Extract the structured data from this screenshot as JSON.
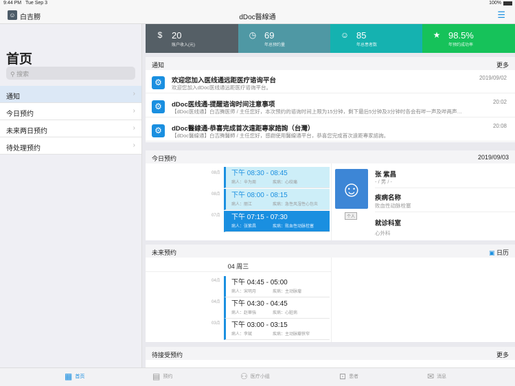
{
  "status": {
    "time": "9:44 PM",
    "date": "Tue Sep 3",
    "battery": "100%"
  },
  "nav": {
    "user": "白吉朥",
    "title": "dDoc醫線通"
  },
  "sidebar": {
    "title": "首页",
    "search_placeholder": "搜索",
    "items": [
      {
        "label": "通知"
      },
      {
        "label": "今日预约"
      },
      {
        "label": "未来两日预约"
      },
      {
        "label": "待处理预约"
      }
    ]
  },
  "stats": [
    {
      "value": "20",
      "label": "账户收入(元)",
      "color": "#555f66",
      "icon": "$"
    },
    {
      "value": "69",
      "label": "年总预约量",
      "color": "#4f98a4",
      "icon": "◷"
    },
    {
      "value": "85",
      "label": "年总患者数",
      "color": "#15b2b0",
      "icon": "☺"
    },
    {
      "value": "98.5%",
      "label": "年预约成功率",
      "color": "#16c25a",
      "icon": "★"
    }
  ],
  "notices": {
    "title": "通知",
    "more": "更多",
    "items": [
      {
        "title": "欢迎您加入医线通远距医疗谘询平台",
        "summary": "欢迎您加入dDoc医线通远距医疗谘询平台。",
        "date": "2019/09/02"
      },
      {
        "title": "dDoc医线通-提醒谘询时间注意事项",
        "summary": "【dDoc医线通】白吉腾医师 / 主任您好，本次预约的谘询时间上限为15分钟，剩下最后5分钟及3分钟时各会有哔一声及哔两声…",
        "date": "20:02"
      },
      {
        "title": "dDoc醫線通-恭喜完成首次遠距專家諮詢（台灣）",
        "summary": "【dDoc醫線通】白吉腾醫師 / 主任您好，感謝使用醫線通平台，恭喜您完成首次遠距專家諮詢。",
        "date": "20:08"
      }
    ]
  },
  "today": {
    "title": "今日预约",
    "date": "2019/09/03",
    "appointments": [
      {
        "hour": "08点",
        "time": "下午  08:30  -  08:45",
        "patient": "病人：辛为周",
        "disease": "疾病：心绞痛"
      },
      {
        "hour": "08点",
        "time": "下午  08:00  -  08:15",
        "patient": "病人：丽江",
        "disease": "疾病：急性风湿性心包炎"
      },
      {
        "hour": "07点",
        "time": "下午  07:15  -  07:30",
        "patient": "病人：张紫昌",
        "disease": "疾病：败血性动脉栓塞"
      }
    ],
    "patient": {
      "name": "张 紫昌",
      "meta": "- / 男 / -",
      "tag": "个人",
      "disease_label": "疾病名称",
      "disease": "败血性动脉栓塞",
      "dept_label": "就诊科室",
      "dept": "心外科"
    }
  },
  "future": {
    "title": "未来预约",
    "calendar": "日历",
    "day": "04 周三",
    "appointments": [
      {
        "hour": "04点",
        "time": "下午  04:45  -  05:00",
        "patient": "病人：宋明月",
        "disease": "疾病：主动脉瘤"
      },
      {
        "hour": "04点",
        "time": "下午  04:30  -  04:45",
        "patient": "病人：赵華強",
        "disease": "疾病：心脏病"
      },
      {
        "hour": "03点",
        "time": "下午  03:00  -  03:15",
        "patient": "病人：李斌",
        "disease": "疾病：主动脉瓣狭窄"
      }
    ]
  },
  "pending": {
    "title": "待接受预约",
    "more": "更多"
  },
  "tabs": [
    {
      "label": "首页",
      "icon": "▦"
    },
    {
      "label": "预约",
      "icon": "▤"
    },
    {
      "label": "医疗小组",
      "icon": "⚇"
    },
    {
      "label": "患者",
      "icon": "⊡"
    },
    {
      "label": "消息",
      "icon": "✉"
    }
  ],
  "colors": {
    "accent": "#1a8fe0"
  }
}
